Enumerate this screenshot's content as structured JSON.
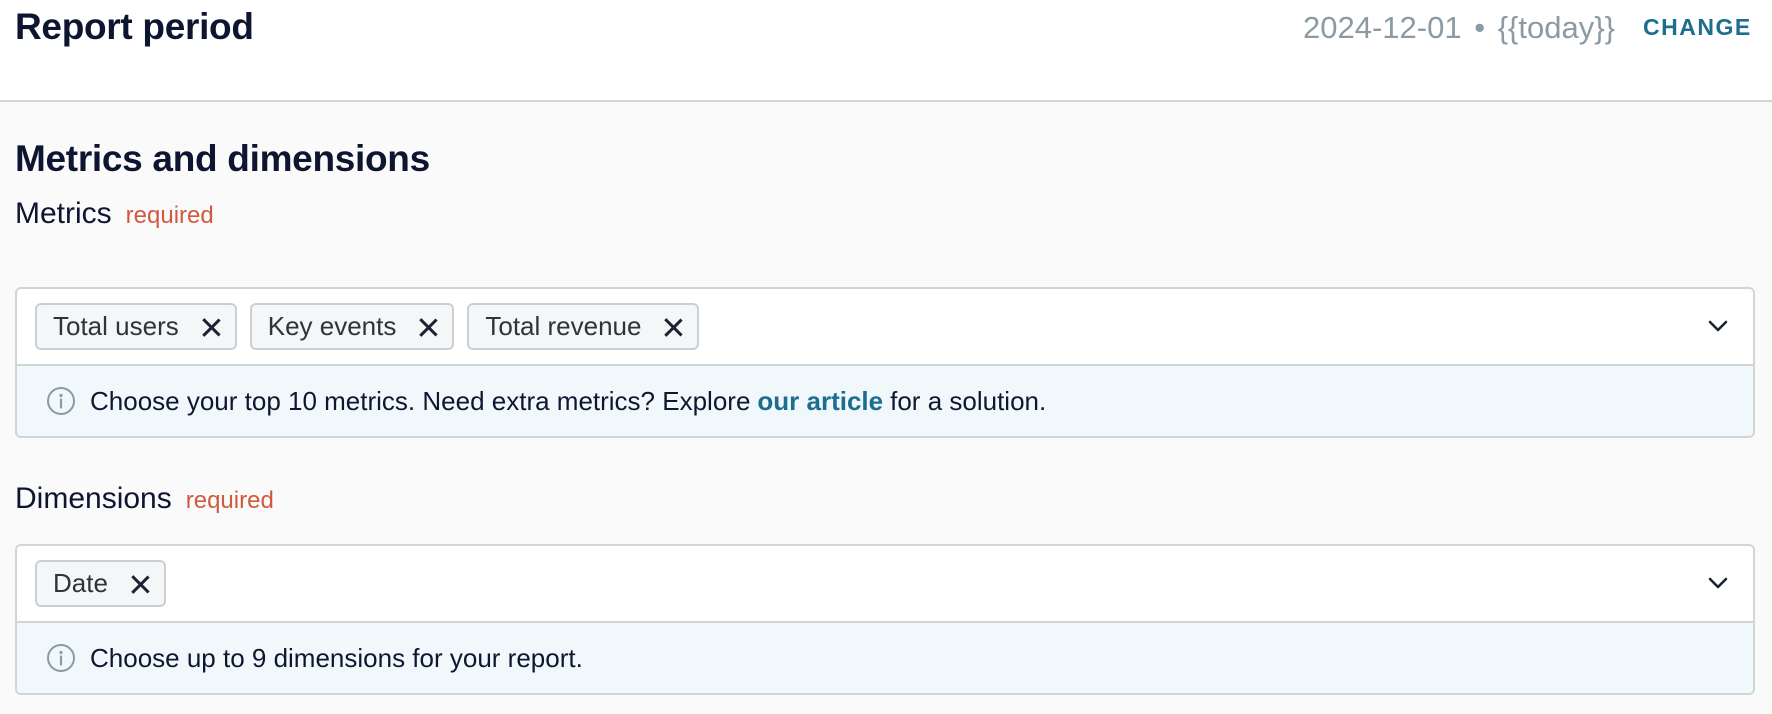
{
  "report_period": {
    "title": "Report period",
    "start_date": "2024-12-01",
    "separator": "•",
    "end_date": "{{today}}",
    "change_label": "CHANGE"
  },
  "section": {
    "title": "Metrics and dimensions"
  },
  "metrics": {
    "label": "Metrics",
    "required_label": "required",
    "chips": [
      "Total users",
      "Key events",
      "Total revenue"
    ],
    "hint_before": "Choose your top 10 metrics. Need extra metrics? Explore",
    "hint_link": "our article",
    "hint_after": "for a solution."
  },
  "dimensions": {
    "label": "Dimensions",
    "required_label": "required",
    "chips": [
      "Date"
    ],
    "hint": "Choose up to 9 dimensions for your report."
  },
  "icons": {
    "chip_remove": "close-icon",
    "dropdown": "chevron-down-icon",
    "hint": "info-icon"
  },
  "colors": {
    "accent": "#1c6e91",
    "required": "#cf5a3f",
    "muted": "#8c9aa3",
    "hint_bg": "#f1f8fb"
  }
}
